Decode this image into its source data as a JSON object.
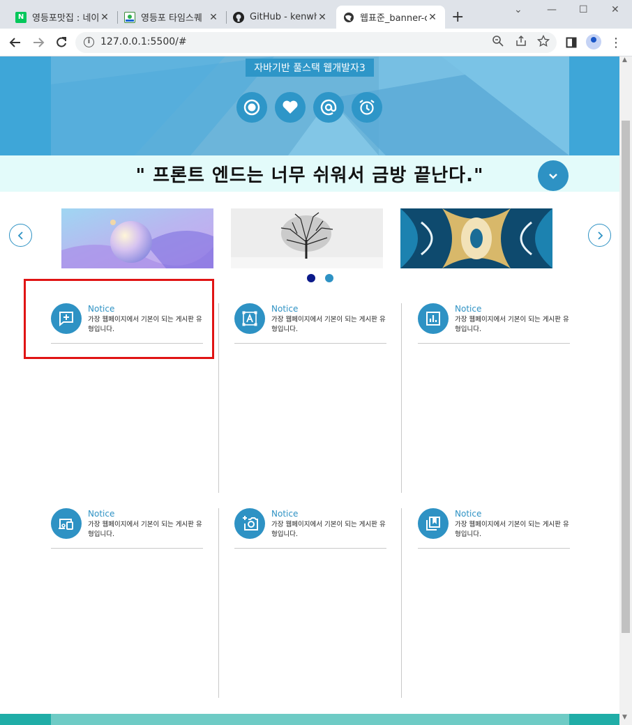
{
  "browser": {
    "tabs": [
      {
        "title": "영등포맛집 : 네이",
        "icon": "naver-icon",
        "active": false
      },
      {
        "title": "영등포 타임스퀘",
        "icon": "map-pin-icon",
        "active": false
      },
      {
        "title": "GitHub - kenwhe",
        "icon": "github-icon",
        "active": false
      },
      {
        "title": "웹표준_banner-c",
        "icon": "globe-icon",
        "active": true
      }
    ],
    "url": "127.0.0.1:5500/#"
  },
  "hero": {
    "tag": "자바기반 풀스택 웹개발자3",
    "icons": [
      "record-icon",
      "heart-icon",
      "at-icon",
      "alarm-icon"
    ]
  },
  "quote": {
    "text": "\" 프론트 엔드는 너무 쉬워서 금방 끝난다.\""
  },
  "slider": {
    "slides": [
      "gradient-spheres-image",
      "winter-tree-image",
      "kaleidoscope-image"
    ],
    "dots": 2,
    "active_dot": 0,
    "colors": {
      "active": "#0b1a8a",
      "inactive": "#2e92c4"
    }
  },
  "cards": [
    {
      "title": "Notice",
      "desc": "가장 웹페이지에서 기본이 되는 게시판 유형입니다.",
      "icon": "add-comment-icon"
    },
    {
      "title": "Notice",
      "desc": "가장 웹페이지에서 기본이 되는 게시판 유형입니다.",
      "icon": "text-frame-icon"
    },
    {
      "title": "Notice",
      "desc": "가장 웹페이지에서 기본이 되는 게시판 유형입니다.",
      "icon": "bar-chart-icon"
    },
    {
      "title": "Notice",
      "desc": "가장 웹페이지에서 기본이 되는 게시판 유형입니다.",
      "icon": "devices-icon"
    },
    {
      "title": "Notice",
      "desc": "가장 웹페이지에서 기본이 되는 게시판 유형입니다.",
      "icon": "add-camera-icon"
    },
    {
      "title": "Notice",
      "desc": "가장 웹페이지에서 기본이 되는 게시판 유형입니다.",
      "icon": "bookmarks-icon"
    }
  ],
  "theme": {
    "accent": "#2e92c4",
    "highlight": "#e01414"
  }
}
